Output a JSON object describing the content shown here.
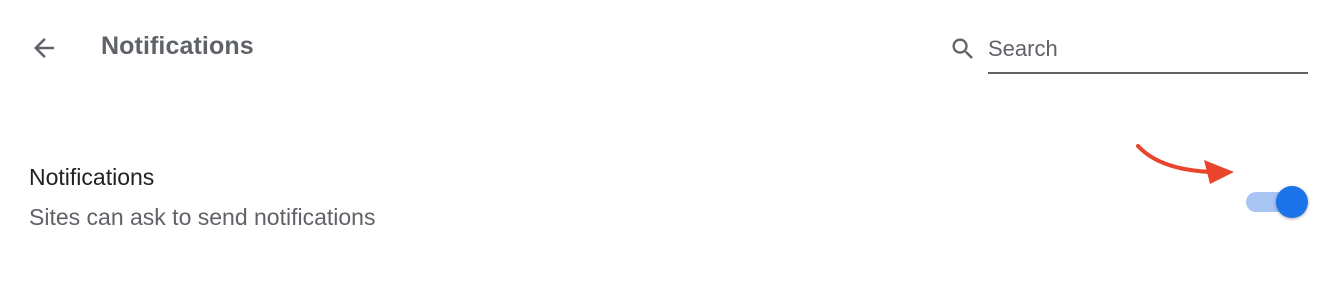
{
  "header": {
    "back_icon": "arrow-back-icon",
    "title": "Notifications"
  },
  "search": {
    "icon": "search-icon",
    "placeholder": "Search",
    "value": ""
  },
  "setting": {
    "title": "Notifications",
    "description": "Sites can ask to send notifications",
    "toggle_on": true
  },
  "colors": {
    "toggle_knob": "#1a73e8",
    "toggle_track": "#a8c4f3",
    "annotation_arrow": "#e8452c",
    "title_gray": "#5f6368"
  }
}
